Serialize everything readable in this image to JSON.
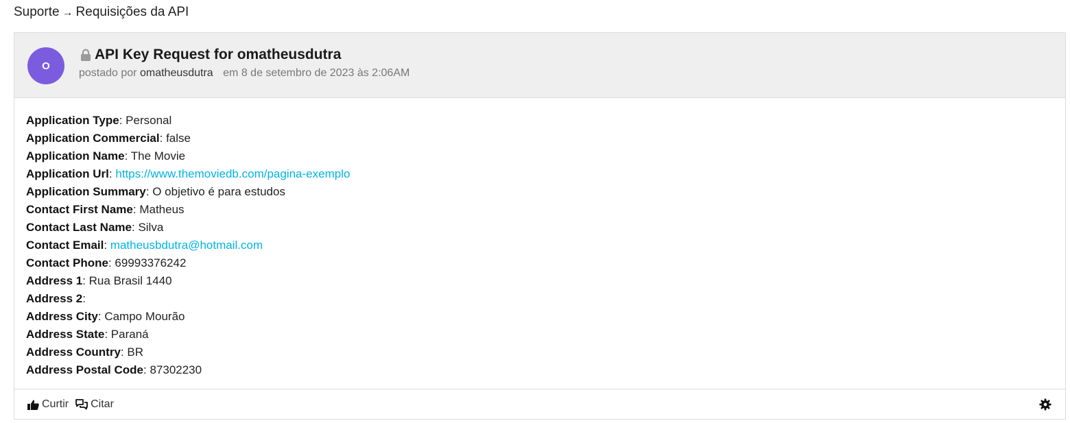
{
  "breadcrumb": {
    "parent": "Suporte",
    "separator": "→",
    "current": "Requisições da API"
  },
  "post": {
    "avatar_initial": "O",
    "avatar_color": "#7b5cdf",
    "title": "API Key Request for omatheusdutra",
    "posted_by_prefix": "postado por",
    "author": "omatheusdutra",
    "date": "em 8 de setembro de 2023 às 2:06AM"
  },
  "fields": [
    {
      "key": "Application Type",
      "value": "Personal"
    },
    {
      "key": "Application Commercial",
      "value": "false"
    },
    {
      "key": "Application Name",
      "value": "The Movie"
    },
    {
      "key": "Application Url",
      "value": "https://www.themoviedb.com/pagina-exemplo"
    },
    {
      "key": "Application Summary",
      "value": "O objetivo é para estudos"
    },
    {
      "key": "Contact First Name",
      "value": "Matheus"
    },
    {
      "key": "Contact Last Name",
      "value": "Silva"
    },
    {
      "key": "Contact Email",
      "value": "matheusbdutra@hotmail.com"
    },
    {
      "key": "Contact Phone",
      "value": "69993376242"
    },
    {
      "key": "Address 1",
      "value": "Rua Brasil 1440"
    },
    {
      "key": "Address 2",
      "value": ""
    },
    {
      "key": "Address City",
      "value": "Campo Mourão"
    },
    {
      "key": "Address State",
      "value": "Paraná"
    },
    {
      "key": "Address Country",
      "value": "BR"
    },
    {
      "key": "Address Postal Code",
      "value": "87302230"
    }
  ],
  "footer": {
    "like_label": "Curtir",
    "quote_label": "Citar"
  },
  "colors": {
    "link": "#01b4e4",
    "header_bg": "#efefef"
  }
}
